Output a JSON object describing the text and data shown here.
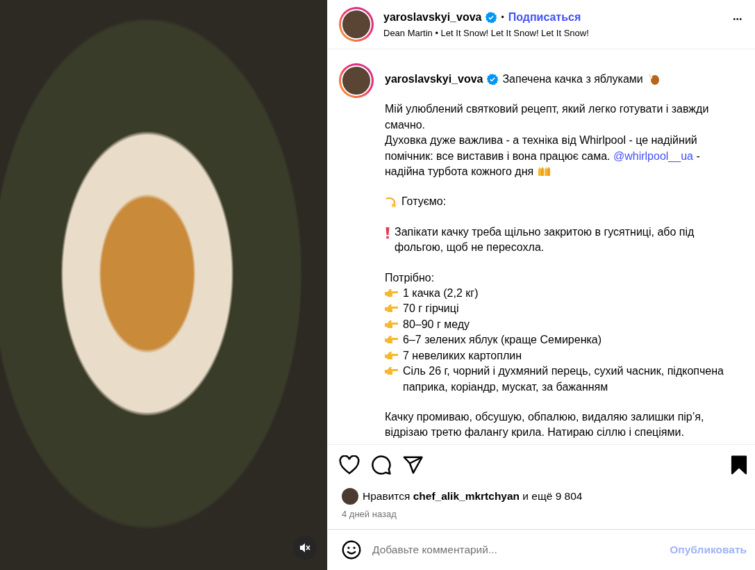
{
  "photo": {
    "muted": true
  },
  "header": {
    "username": "yaroslavskyi_vova",
    "verified": true,
    "separator": "•",
    "follow": "Подписаться",
    "music": "Dean Martin • Let It Snow! Let It Snow! Let It Snow!",
    "more": "•••"
  },
  "caption": {
    "username": "yaroslavskyi_vova",
    "verified": true,
    "title": "Запечена качка з яблуками",
    "sections": [
      [
        {
          "kind": "text",
          "text": "Мій улюблений святковий рецепт, який легко готувати і завжди смачно."
        },
        {
          "kind": "promo",
          "text": "Духовка дуже важлива - а техніка від Whirlpool - це надійний помічник: все виставив і вона працює сама.",
          "mention": "@whirlpool__ua",
          "text_after": "- надійна турбота кожного дня"
        }
      ],
      [
        {
          "kind": "heading",
          "text": "Готуємо:"
        }
      ],
      [
        {
          "kind": "warning",
          "text": "Запікати качку треба щільно закритою в гусятниці, або під фольгою, щоб не пересохла."
        }
      ],
      [
        {
          "kind": "text",
          "text": "Потрібно:"
        },
        {
          "kind": "bullet",
          "text": "1 качка (2,2 кг)"
        },
        {
          "kind": "bullet",
          "text": "70 г гірчиці"
        },
        {
          "kind": "bullet",
          "text": "80–90 г меду"
        },
        {
          "kind": "bullet",
          "text": "6–7 зелених яблук (краще Семиренка)"
        },
        {
          "kind": "bullet",
          "text": "7 невеликих картоплин"
        },
        {
          "kind": "bullet",
          "text": "Сіль 26 г, чорний і духмяний перець, сухий часник, підкопчена паприка, коріандр, мускат, за бажанням"
        }
      ],
      [
        {
          "kind": "text",
          "text": "Качку промиваю, обсушую, обпалюю, видаляю залишки пір’я, відрізаю третю фалангу крила. Натираю сіллю і спеціями."
        }
      ]
    ]
  },
  "actions": {
    "liked": false,
    "saved": true
  },
  "likes": {
    "text": "Нравится **chef_alik_mkrtchyan** и ещё 9 804"
  },
  "time": "4 дней назад",
  "comment": {
    "placeholder": "Добавьте комментарий...",
    "post": "Опубликовать",
    "post_disabled": true
  }
}
